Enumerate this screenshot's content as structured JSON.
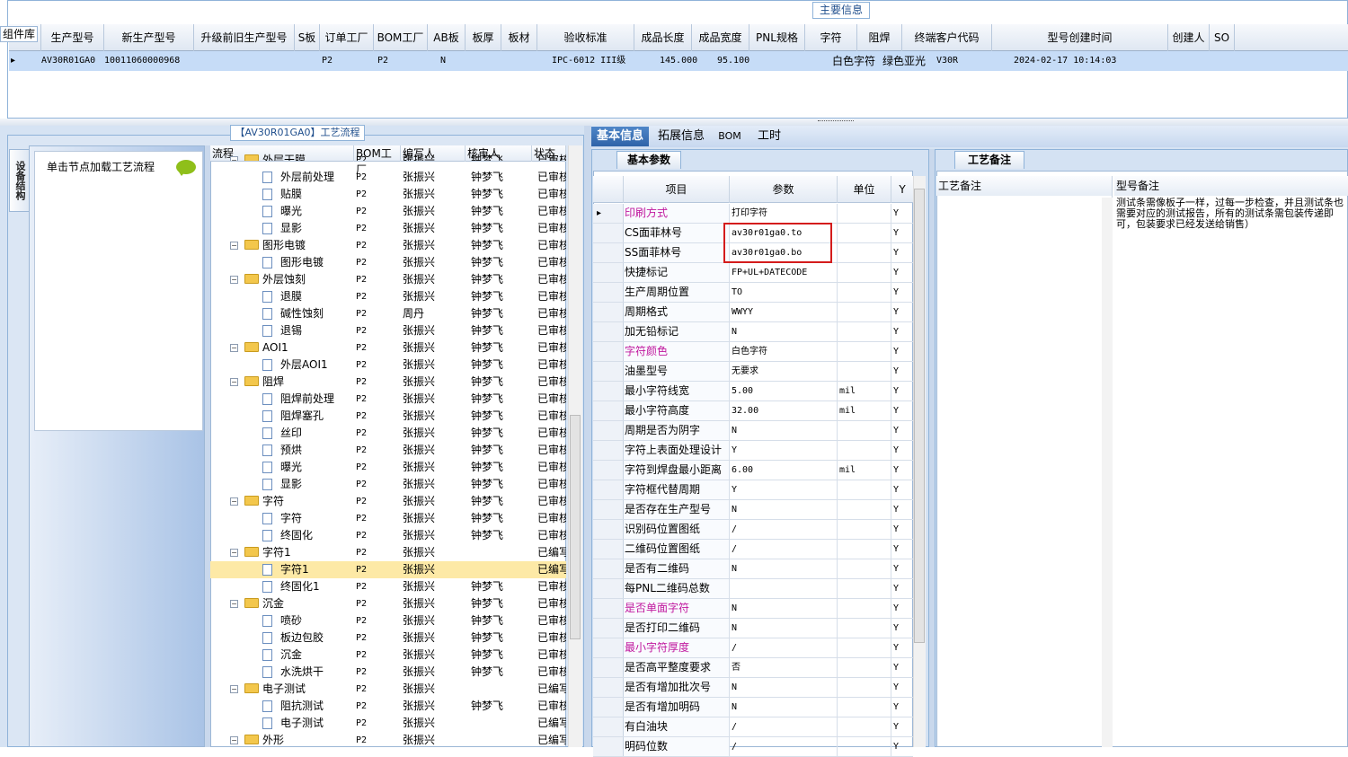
{
  "top": {
    "title_tab": "主要信息",
    "component_lib": "组件库",
    "columns": [
      "生产型号",
      "新生产型号",
      "升级前旧生产型号",
      "S板",
      "订单工厂",
      "BOM工厂",
      "AB板",
      "板厚",
      "板材",
      "验收标准",
      "成品长度",
      "成品宽度",
      "PNL规格",
      "字符",
      "阻焊",
      "终端客户代码",
      "型号创建时间",
      "创建人",
      "SO"
    ],
    "row": {
      "arrow": "▸",
      "model": "AV30R01GA0",
      "new_model": "10011060000968",
      "order_factory": "P2",
      "bom_factory": "P2",
      "ab": "N",
      "standard": "IPC-6012 III级",
      "length": "145.000",
      "width": "95.100",
      "char": "白色字符",
      "solder": "绿色亚光",
      "customer": "V30R",
      "created": "2024-02-17 10:14:03"
    }
  },
  "left": {
    "process_title": "【AV30R01GA0】工艺流程",
    "vertical_tab": "设备结构",
    "nav_hint": "单击节点加载工艺流程",
    "tree_columns": [
      "流程",
      "BOM工厂",
      "编写人",
      "核审人",
      "状态"
    ],
    "rows": [
      {
        "label": "外层干膜",
        "f": "P2",
        "w": "张振兴",
        "r": "钟梦飞",
        "s": "已审核",
        "type": "folder",
        "partial": true
      },
      {
        "label": "外层前处理",
        "f": "P2",
        "w": "张振兴",
        "r": "钟梦飞",
        "s": "已审核",
        "type": "doc"
      },
      {
        "label": "贴膜",
        "f": "P2",
        "w": "张振兴",
        "r": "钟梦飞",
        "s": "已审核",
        "type": "doc"
      },
      {
        "label": "曝光",
        "f": "P2",
        "w": "张振兴",
        "r": "钟梦飞",
        "s": "已审核",
        "type": "doc"
      },
      {
        "label": "显影",
        "f": "P2",
        "w": "张振兴",
        "r": "钟梦飞",
        "s": "已审核",
        "type": "doc"
      },
      {
        "label": "图形电镀",
        "f": "P2",
        "w": "张振兴",
        "r": "钟梦飞",
        "s": "已审核",
        "type": "folder"
      },
      {
        "label": "图形电镀",
        "f": "P2",
        "w": "张振兴",
        "r": "钟梦飞",
        "s": "已审核",
        "type": "doc"
      },
      {
        "label": "外层蚀刻",
        "f": "P2",
        "w": "张振兴",
        "r": "钟梦飞",
        "s": "已审核",
        "type": "folder"
      },
      {
        "label": "退膜",
        "f": "P2",
        "w": "张振兴",
        "r": "钟梦飞",
        "s": "已审核",
        "type": "doc"
      },
      {
        "label": "碱性蚀刻",
        "f": "P2",
        "w": "周丹",
        "r": "钟梦飞",
        "s": "已审核",
        "type": "doc"
      },
      {
        "label": "退锡",
        "f": "P2",
        "w": "张振兴",
        "r": "钟梦飞",
        "s": "已审核",
        "type": "doc"
      },
      {
        "label": "AOI1",
        "f": "P2",
        "w": "张振兴",
        "r": "钟梦飞",
        "s": "已审核",
        "type": "folder"
      },
      {
        "label": "外层AOI1",
        "f": "P2",
        "w": "张振兴",
        "r": "钟梦飞",
        "s": "已审核",
        "type": "doc"
      },
      {
        "label": "阻焊",
        "f": "P2",
        "w": "张振兴",
        "r": "钟梦飞",
        "s": "已审核",
        "type": "folder"
      },
      {
        "label": "阻焊前处理",
        "f": "P2",
        "w": "张振兴",
        "r": "钟梦飞",
        "s": "已审核",
        "type": "doc"
      },
      {
        "label": "阻焊塞孔",
        "f": "P2",
        "w": "张振兴",
        "r": "钟梦飞",
        "s": "已审核",
        "type": "doc"
      },
      {
        "label": "丝印",
        "f": "P2",
        "w": "张振兴",
        "r": "钟梦飞",
        "s": "已审核",
        "type": "doc"
      },
      {
        "label": "预烘",
        "f": "P2",
        "w": "张振兴",
        "r": "钟梦飞",
        "s": "已审核",
        "type": "doc"
      },
      {
        "label": "曝光",
        "f": "P2",
        "w": "张振兴",
        "r": "钟梦飞",
        "s": "已审核",
        "type": "doc"
      },
      {
        "label": "显影",
        "f": "P2",
        "w": "张振兴",
        "r": "钟梦飞",
        "s": "已审核",
        "type": "doc"
      },
      {
        "label": "字符",
        "f": "P2",
        "w": "张振兴",
        "r": "钟梦飞",
        "s": "已审核",
        "type": "folder"
      },
      {
        "label": "字符",
        "f": "P2",
        "w": "张振兴",
        "r": "钟梦飞",
        "s": "已审核",
        "type": "doc"
      },
      {
        "label": "终固化",
        "f": "P2",
        "w": "张振兴",
        "r": "钟梦飞",
        "s": "已审核",
        "type": "doc"
      },
      {
        "label": "字符1",
        "f": "P2",
        "w": "张振兴",
        "r": "",
        "s": "已编写",
        "type": "folder"
      },
      {
        "label": "字符1",
        "f": "P2",
        "w": "张振兴",
        "r": "",
        "s": "已编写",
        "type": "doc",
        "selected": true
      },
      {
        "label": "终固化1",
        "f": "P2",
        "w": "张振兴",
        "r": "钟梦飞",
        "s": "已审核",
        "type": "doc"
      },
      {
        "label": "沉金",
        "f": "P2",
        "w": "张振兴",
        "r": "钟梦飞",
        "s": "已审核",
        "type": "folder"
      },
      {
        "label": "喷砂",
        "f": "P2",
        "w": "张振兴",
        "r": "钟梦飞",
        "s": "已审核",
        "type": "doc"
      },
      {
        "label": "板边包胶",
        "f": "P2",
        "w": "张振兴",
        "r": "钟梦飞",
        "s": "已审核",
        "type": "doc"
      },
      {
        "label": "沉金",
        "f": "P2",
        "w": "张振兴",
        "r": "钟梦飞",
        "s": "已审核",
        "type": "doc"
      },
      {
        "label": "水洗烘干",
        "f": "P2",
        "w": "张振兴",
        "r": "钟梦飞",
        "s": "已审核",
        "type": "doc"
      },
      {
        "label": "电子测试",
        "f": "P2",
        "w": "张振兴",
        "r": "",
        "s": "已编写",
        "type": "folder"
      },
      {
        "label": "阻抗测试",
        "f": "P2",
        "w": "张振兴",
        "r": "钟梦飞",
        "s": "已审核",
        "type": "doc"
      },
      {
        "label": "电子测试",
        "f": "P2",
        "w": "张振兴",
        "r": "",
        "s": "已编写",
        "type": "doc"
      },
      {
        "label": "外形",
        "f": "P2",
        "w": "张振兴",
        "r": "",
        "s": "已编写",
        "type": "folder"
      }
    ]
  },
  "right": {
    "tabs": [
      "基本信息",
      "拓展信息",
      "BOM",
      "工时"
    ],
    "params_tab": "基本参数",
    "param_columns": [
      "项目",
      "参数",
      "单位",
      "Y"
    ],
    "params": [
      {
        "item": "印刷方式",
        "value": "打印字符",
        "unit": "",
        "flag": "Y",
        "magenta": true,
        "current": true
      },
      {
        "item": "CS面菲林号",
        "value": "av30r01ga0.to",
        "unit": "",
        "flag": "Y"
      },
      {
        "item": "SS面菲林号",
        "value": "av30r01ga0.bo",
        "unit": "",
        "flag": "Y"
      },
      {
        "item": "快捷标记",
        "value": "FP+UL+DATECODE",
        "unit": "",
        "flag": "Y"
      },
      {
        "item": "生产周期位置",
        "value": "TO",
        "unit": "",
        "flag": "Y"
      },
      {
        "item": "周期格式",
        "value": "WWYY",
        "unit": "",
        "flag": "Y"
      },
      {
        "item": "加无铅标记",
        "value": "N",
        "unit": "",
        "flag": "Y"
      },
      {
        "item": "字符颜色",
        "value": "白色字符",
        "unit": "",
        "flag": "Y",
        "magenta": true
      },
      {
        "item": "油墨型号",
        "value": "无要求",
        "unit": "",
        "flag": "Y"
      },
      {
        "item": "最小字符线宽",
        "value": "5.00",
        "unit": "mil",
        "flag": "Y"
      },
      {
        "item": "最小字符高度",
        "value": "32.00",
        "unit": "mil",
        "flag": "Y"
      },
      {
        "item": "周期是否为阴字",
        "value": "N",
        "unit": "",
        "flag": "Y"
      },
      {
        "item": "字符上表面处理设计",
        "value": "Y",
        "unit": "",
        "flag": "Y"
      },
      {
        "item": "字符到焊盘最小距离",
        "value": "6.00",
        "unit": "mil",
        "flag": "Y"
      },
      {
        "item": "字符框代替周期",
        "value": "Y",
        "unit": "",
        "flag": "Y"
      },
      {
        "item": "是否存在生产型号",
        "value": "N",
        "unit": "",
        "flag": "Y"
      },
      {
        "item": "识别码位置图纸",
        "value": "/",
        "unit": "",
        "flag": "Y"
      },
      {
        "item": "二维码位置图纸",
        "value": "/",
        "unit": "",
        "flag": "Y"
      },
      {
        "item": "是否有二维码",
        "value": "N",
        "unit": "",
        "flag": "Y"
      },
      {
        "item": "每PNL二维码总数",
        "value": "",
        "unit": "",
        "flag": "Y"
      },
      {
        "item": "是否单面字符",
        "value": "N",
        "unit": "",
        "flag": "Y",
        "magenta": true
      },
      {
        "item": "是否打印二维码",
        "value": "N",
        "unit": "",
        "flag": "Y"
      },
      {
        "item": "最小字符厚度",
        "value": "/",
        "unit": "",
        "flag": "Y",
        "magenta": true
      },
      {
        "item": "是否高平整度要求",
        "value": "否",
        "unit": "",
        "flag": "Y"
      },
      {
        "item": "是否有增加批次号",
        "value": "N",
        "unit": "",
        "flag": "Y"
      },
      {
        "item": "是否有增加明码",
        "value": "N",
        "unit": "",
        "flag": "Y"
      },
      {
        "item": "有白油块",
        "value": "/",
        "unit": "",
        "flag": "Y"
      },
      {
        "item": "明码位数",
        "value": "/",
        "unit": "",
        "flag": "Y"
      }
    ],
    "notes_tab": "工艺备注",
    "notes_col1": "工艺备注",
    "notes_col2": "型号备注",
    "model_note": "测试条需像板子一样，过每一步检查，并且测试条也需要对应的测试报告，所有的测试条需包装传递即可，包装要求已经发送给销售）"
  }
}
